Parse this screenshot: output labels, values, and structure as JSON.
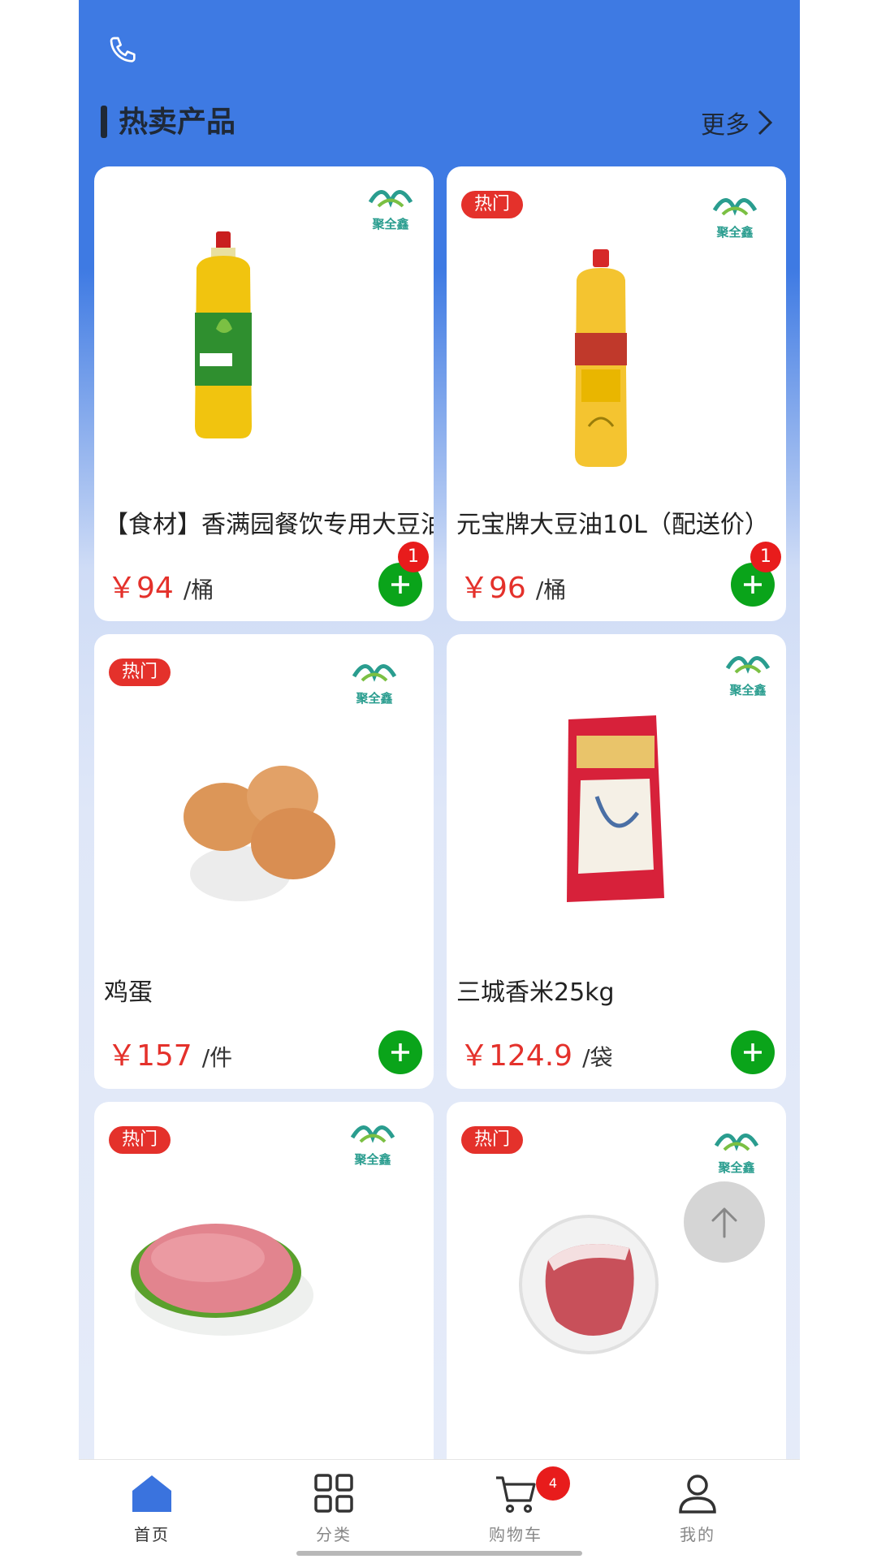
{
  "section": {
    "title": "热卖产品",
    "more_label": "更多"
  },
  "products": [
    {
      "name": "【食材】香满园餐饮专用大豆油",
      "price": "￥94",
      "unit": "/桶",
      "hot": "",
      "badge": "1",
      "icon": "oil-bottle-green"
    },
    {
      "name": "元宝牌大豆油10L（配送价）",
      "price": "￥96",
      "unit": "/桶",
      "hot": "热门",
      "badge": "1",
      "icon": "oil-bottle-red"
    },
    {
      "name": "鸡蛋",
      "price": "￥157",
      "unit": "/件",
      "hot": "热门",
      "badge": "",
      "icon": "eggs"
    },
    {
      "name": "三城香米25kg",
      "price": "￥124.9",
      "unit": "/袋",
      "hot": "",
      "badge": "",
      "icon": "rice-bag"
    },
    {
      "name": "",
      "price": "",
      "unit": "",
      "hot": "热门",
      "badge": "",
      "icon": "pork"
    },
    {
      "name": "",
      "price": "",
      "unit": "",
      "hot": "热门",
      "badge": "",
      "icon": "pork-slice"
    }
  ],
  "brand_logo": {
    "text": "聚全鑫"
  },
  "tabbar": {
    "home": "首页",
    "category": "分类",
    "cart": "购物车",
    "cart_badge": "4",
    "mine": "我的"
  },
  "colors": {
    "header": "#3e7ae3",
    "price": "#e4312b",
    "add": "#0aa41a",
    "active_tab": "#3a73de"
  }
}
